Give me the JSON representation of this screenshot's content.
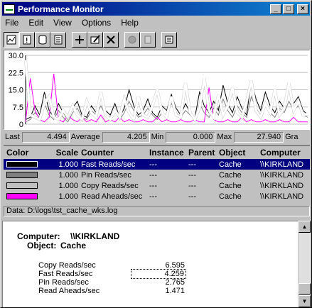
{
  "window": {
    "title": "Performance Monitor"
  },
  "menu": [
    "File",
    "Edit",
    "View",
    "Options",
    "Help"
  ],
  "toolbar": {
    "icons": [
      "chart-view-icon",
      "alert-view-icon",
      "log-view-icon",
      "report-view-icon",
      "add-counter-icon",
      "edit-counter-icon",
      "delete-counter-icon",
      "update-now-icon",
      "bookmark-icon",
      "options-icon"
    ]
  },
  "chart_data": {
    "type": "line",
    "ylim": [
      0,
      30
    ],
    "yticks": [
      "30.0",
      "22.5",
      "15.0",
      "7.5",
      "0"
    ],
    "grid": true,
    "series": [
      {
        "name": "Fast Reads/sec",
        "color": "#000000",
        "values": [
          2,
          3,
          8,
          4,
          14,
          6,
          3,
          9,
          5,
          2,
          7,
          10,
          4,
          3,
          8,
          5,
          12,
          6,
          4,
          9,
          3,
          7,
          15,
          8,
          4,
          6,
          11,
          5,
          3,
          8,
          6,
          13,
          7,
          4,
          9,
          5,
          3,
          14,
          8,
          5,
          10,
          6,
          17,
          9,
          5,
          12,
          7,
          4,
          19,
          11,
          6,
          14,
          8,
          5,
          10,
          7,
          16,
          9,
          12,
          6,
          4
        ]
      },
      {
        "name": "Pin Reads/sec",
        "color": "#808080",
        "values": [
          1,
          2,
          5,
          3,
          9,
          4,
          2,
          6,
          3,
          1,
          5,
          7,
          3,
          2,
          6,
          4,
          8,
          4,
          3,
          6,
          2,
          5,
          10,
          6,
          3,
          4,
          7,
          4,
          2,
          5,
          4,
          9,
          5,
          3,
          6,
          4,
          2,
          9,
          5,
          3,
          7,
          4,
          11,
          6,
          3,
          8,
          5,
          3,
          12,
          7,
          4,
          9,
          5,
          3,
          7,
          5,
          10,
          6,
          8,
          4,
          3
        ]
      },
      {
        "name": "Copy Reads/sec",
        "color": "#ffffff",
        "values": [
          27.9,
          4,
          3,
          2,
          9,
          12,
          3,
          2,
          6,
          3,
          8,
          4,
          2,
          10,
          5,
          3,
          14,
          4,
          2,
          6,
          3,
          11,
          5,
          2,
          12,
          4,
          3,
          8,
          15,
          5,
          3,
          12,
          4,
          3,
          18,
          5,
          2,
          7,
          20,
          6,
          3,
          13,
          4,
          8,
          16,
          5,
          3,
          10,
          19,
          6,
          3,
          9,
          5,
          15,
          4,
          7,
          18,
          6,
          10,
          4,
          4.5
        ]
      },
      {
        "name": "Read Aheads/sec",
        "color": "#ff00ff",
        "values": [
          1,
          20,
          6,
          2,
          1,
          3,
          22,
          2,
          1,
          4,
          2,
          1,
          3,
          1,
          2,
          1,
          4,
          1,
          2,
          1,
          3,
          1,
          2,
          1,
          1,
          2,
          1,
          1,
          3,
          1,
          2,
          1,
          1,
          2,
          1,
          1,
          2,
          1,
          1,
          16,
          2,
          1,
          1,
          2,
          1,
          1,
          3,
          1,
          2,
          1,
          1,
          2,
          1,
          1,
          2,
          1,
          1,
          3,
          1,
          1,
          1
        ]
      }
    ]
  },
  "values": {
    "last_label": "Last",
    "last": "4.494",
    "average_label": "Average",
    "average": "4.205",
    "min_label": "Min",
    "min": "0.000",
    "max_label": "Max",
    "max": "27.940",
    "graph_label": "Gra"
  },
  "legend": {
    "headers": {
      "color": "Color",
      "scale": "Scale",
      "counter": "Counter",
      "instance": "Instance",
      "parent": "Parent",
      "object": "Object",
      "computer": "Computer"
    },
    "rows": [
      {
        "color": "#000000",
        "scale": "1.000",
        "counter": "Fast Reads/sec",
        "instance": "---",
        "parent": "---",
        "object": "Cache",
        "computer": "\\\\KIRKLAND"
      },
      {
        "color": "#808080",
        "scale": "1.000",
        "counter": "Pin Reads/sec",
        "instance": "---",
        "parent": "---",
        "object": "Cache",
        "computer": "\\\\KIRKLAND"
      },
      {
        "color": "#c0c0c0",
        "scale": "1.000",
        "counter": "Copy Reads/sec",
        "instance": "---",
        "parent": "---",
        "object": "Cache",
        "computer": "\\\\KIRKLAND"
      },
      {
        "color": "#ff00ff",
        "scale": "1.000",
        "counter": "Read Aheads/sec",
        "instance": "---",
        "parent": "---",
        "object": "Cache",
        "computer": "\\\\KIRKLAND"
      }
    ]
  },
  "status": {
    "data": "Data: D:\\logs\\tst_cache_wks.log"
  },
  "report": {
    "computer_label": "Computer:",
    "computer": "\\\\KIRKLAND",
    "object_label": "Object:",
    "object": "Cache",
    "rows": [
      {
        "label": "Copy Reads/sec",
        "value": "6.595"
      },
      {
        "label": "Fast Reads/sec",
        "value": "4.259"
      },
      {
        "label": "Pin Reads/sec",
        "value": "2.765"
      },
      {
        "label": "Read Aheads/sec",
        "value": "1.471"
      }
    ]
  }
}
